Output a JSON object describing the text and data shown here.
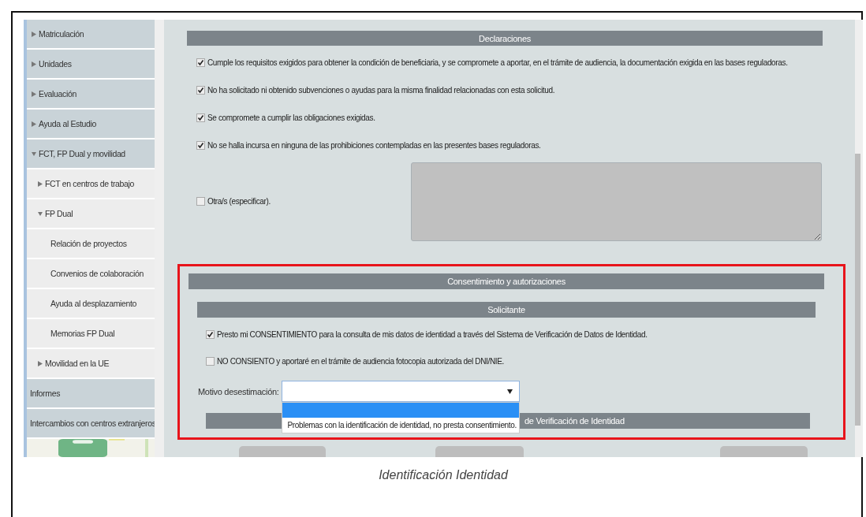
{
  "sidebar": {
    "items": [
      {
        "label": "Matriculación",
        "kind": "group",
        "expanded": false
      },
      {
        "label": "Unidades",
        "kind": "group",
        "expanded": false
      },
      {
        "label": "Evaluación",
        "kind": "group",
        "expanded": false
      },
      {
        "label": "Ayuda al Estudio",
        "kind": "group",
        "expanded": false
      },
      {
        "label": "FCT, FP Dual y movilidad",
        "kind": "group",
        "expanded": true,
        "children": [
          {
            "label": "FCT en centros de trabajo",
            "kind": "group",
            "expanded": false
          },
          {
            "label": "FP Dual",
            "kind": "group",
            "expanded": true,
            "children": [
              {
                "label": "Relación de proyectos",
                "kind": "link"
              },
              {
                "label": "Convenios de colaboración",
                "kind": "link"
              },
              {
                "label": "Ayuda al desplazamiento",
                "kind": "link"
              },
              {
                "label": "Memorias FP Dual",
                "kind": "link"
              }
            ]
          },
          {
            "label": "Movilidad en la UE",
            "kind": "group",
            "expanded": false
          }
        ]
      },
      {
        "label": "Informes",
        "kind": "link"
      },
      {
        "label": "Intercambios con centros extranjeros",
        "kind": "link"
      }
    ]
  },
  "declarations": {
    "title": "Declaraciones",
    "items": [
      {
        "text": "Cumple los requisitos exigidos para obtener la condición de beneficiaria, y se compromete a aportar, en el trámite de audiencia, la documentación exigida en las bases reguladoras.",
        "checked": true
      },
      {
        "text": "No ha solicitado ni obtenido subvenciones o ayudas para la misma finalidad relacionadas con esta solicitud.",
        "checked": true
      },
      {
        "text": "Se compromete a cumplir las obligaciones exigidas.",
        "checked": true
      },
      {
        "text": "No se halla incursa en ninguna de las prohibiciones contempladas en las presentes bases reguladoras.",
        "checked": true
      }
    ],
    "other": {
      "label": "Otra/s (especificar).",
      "checked": false
    }
  },
  "consent": {
    "title": "Consentimiento y autorizaciones",
    "subtitle": "Solicitante",
    "items": [
      {
        "text": "Presto mi CONSENTIMIENTO para la consulta de mis datos de identidad a través del Sistema de Verificación de Datos de Identidad.",
        "checked": true
      },
      {
        "text": "NO CONSIENTO y aportaré en el trámite de audiencia fotocopia autorizada del DNI/NIE.",
        "checked": false
      }
    ],
    "reason_label": "Motivo desestimación:",
    "dropdown_options": [
      {
        "selected": true
      },
      {
        "label": "Problemas con la identificación de identidad, no presta consentimiento.",
        "selected": false
      }
    ],
    "next_section_title": "de Verificación de Identidad"
  },
  "caption": "Identificación Identidad"
}
